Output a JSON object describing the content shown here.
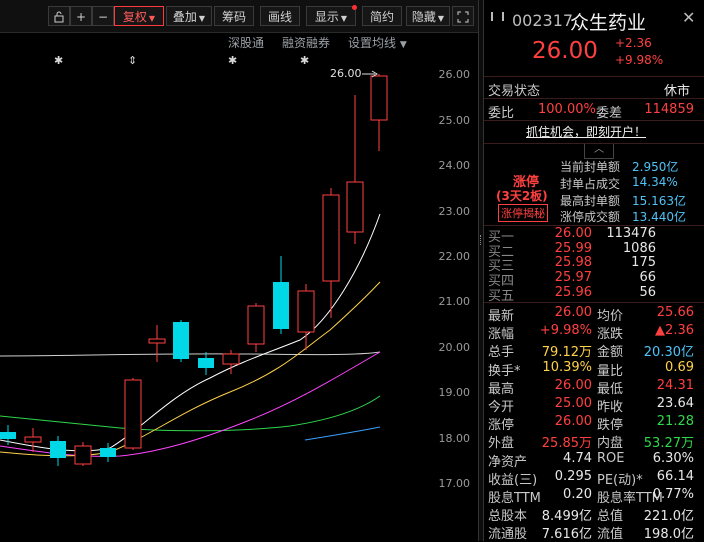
{
  "toolbar": {
    "fuquan": "复权",
    "diejia": "叠加",
    "choumao": "筹码",
    "huaxian": "画线",
    "xianshi": "显示",
    "jianyue": "简约",
    "yincang": "隐藏"
  },
  "sublinks": {
    "shengutong": "深股通",
    "rongzi": "融资融券",
    "shezhi": "设置均线"
  },
  "price_marker": "26.00",
  "price_axis": [
    "26.00",
    "25.00",
    "24.00",
    "23.00",
    "22.00",
    "21.00",
    "20.00",
    "19.00",
    "18.00",
    "17.00"
  ],
  "stock": {
    "code": "002317",
    "name": "众生药业",
    "price": "26.00",
    "change": "+2.36",
    "change_pct": "+9.98%"
  },
  "status": {
    "label": "交易状态",
    "value": "休市"
  },
  "weibi": {
    "label": "委比",
    "value": "100.00%",
    "diff_label": "委差",
    "diff_value": "114859"
  },
  "promo": "抓住机会，即刻开户！",
  "limit": {
    "title": "涨停",
    "days": "(3天2板)",
    "button": "涨停揭秘",
    "rows": [
      {
        "label": "当前封单额",
        "value": "2.950亿"
      },
      {
        "label": "封单占成交",
        "value": "14.34%"
      },
      {
        "label": "最高封单额",
        "value": "15.163亿"
      },
      {
        "label": "涨停成交额",
        "value": "13.440亿"
      }
    ]
  },
  "bids": [
    {
      "label": "买一",
      "price": "26.00",
      "vol": "113476"
    },
    {
      "label": "买二",
      "price": "25.99",
      "vol": "1086"
    },
    {
      "label": "买三",
      "price": "25.98",
      "vol": "175"
    },
    {
      "label": "买四",
      "price": "25.97",
      "vol": "66"
    },
    {
      "label": "买五",
      "price": "25.96",
      "vol": "56"
    }
  ],
  "stats": [
    {
      "l1": "最新",
      "v1": "26.00",
      "c1": "red",
      "l2": "均价",
      "v2": "25.66",
      "c2": "red"
    },
    {
      "l1": "涨幅",
      "v1": "+9.98%",
      "c1": "red",
      "l2": "涨跌",
      "v2": "▲2.36",
      "c2": "red"
    },
    {
      "l1": "总手",
      "v1": "79.12万",
      "c1": "yel",
      "l2": "金额",
      "v2": "20.30亿",
      "c2": "cyn"
    },
    {
      "l1": "换手*",
      "v1": "10.39%",
      "c1": "yel",
      "l2": "量比",
      "v2": "0.69",
      "c2": "yel"
    },
    {
      "l1": "最高",
      "v1": "26.00",
      "c1": "red",
      "l2": "最低",
      "v2": "24.31",
      "c2": "red"
    },
    {
      "l1": "今开",
      "v1": "25.00",
      "c1": "red",
      "l2": "昨收",
      "v2": "23.64",
      "c2": "wht"
    },
    {
      "l1": "涨停",
      "v1": "26.00",
      "c1": "red",
      "l2": "跌停",
      "v2": "21.28",
      "c2": "grn"
    },
    {
      "l1": "外盘",
      "v1": "25.85万",
      "c1": "red",
      "l2": "内盘",
      "v2": "53.27万",
      "c2": "grn"
    },
    {
      "l1": "净资产",
      "v1": "4.74",
      "c1": "wht",
      "l2": "ROE",
      "v2": "6.30%",
      "c2": "wht"
    },
    {
      "l1": "收益(三)",
      "v1": "0.295",
      "c1": "wht",
      "l2": "PE(动)*",
      "v2": "66.14",
      "c2": "wht"
    },
    {
      "l1": "股息TTM",
      "v1": "0.20",
      "c1": "wht",
      "l2": "股息率TTM",
      "v2": "0.77%",
      "c2": "wht"
    },
    {
      "l1": "总股本",
      "v1": "8.499亿",
      "c1": "wht",
      "l2": "总值",
      "v2": "221.0亿",
      "c2": "wht"
    },
    {
      "l1": "流通股",
      "v1": "7.616亿",
      "c1": "wht",
      "l2": "流值",
      "v2": "198.0亿",
      "c2": "wht"
    }
  ],
  "colors": {
    "up": "#ff4040",
    "down": "#00d8e8",
    "ma5": "#ffffff",
    "ma10": "#ffd24a",
    "ma20": "#ff44ff",
    "ma30": "#2fd84b",
    "ma60": "#d0d0d0",
    "ma120": "#3aa0ff"
  }
}
